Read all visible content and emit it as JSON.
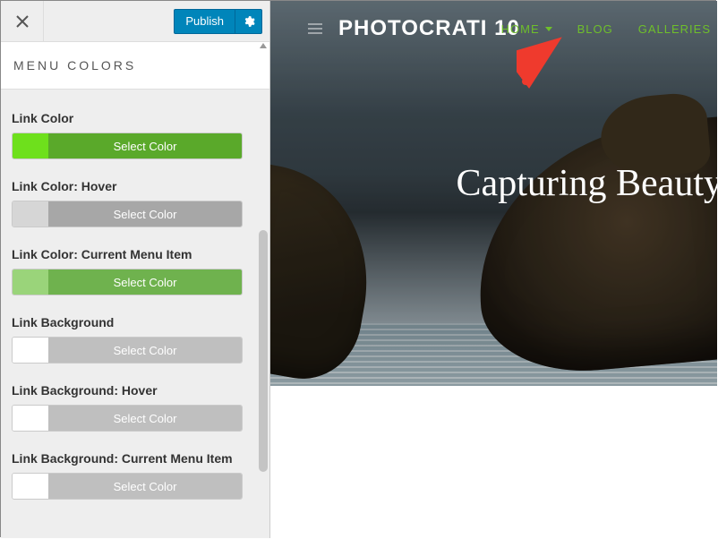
{
  "topbar": {
    "publish_label": "Publish"
  },
  "panel": {
    "title": "MENU COLORS"
  },
  "controls": [
    {
      "label": "Link Color",
      "button_label": "Select Color",
      "swatch": "#6ee01c",
      "bg": "#5aa92a"
    },
    {
      "label": "Link Color: Hover",
      "button_label": "Select Color",
      "swatch": "#d6d6d6",
      "bg": "#a7a7a7"
    },
    {
      "label": "Link Color: Current Menu Item",
      "button_label": "Select Color",
      "swatch": "#9ad47a",
      "bg": "#6fb24e"
    },
    {
      "label": "Link Background",
      "button_label": "Select Color",
      "swatch": "#ffffff",
      "bg": "#bfbfbf"
    },
    {
      "label": "Link Background: Hover",
      "button_label": "Select Color",
      "swatch": "#ffffff",
      "bg": "#bfbfbf"
    },
    {
      "label": "Link Background: Current Menu Item",
      "button_label": "Select Color",
      "swatch": "#ffffff",
      "bg": "#bfbfbf"
    }
  ],
  "preview": {
    "brand": "PHOTOCRATI 10",
    "nav": {
      "home": "HOME",
      "blog": "BLOG",
      "galleries": "GALLERIES"
    },
    "hero_title": "Capturing Beauty"
  }
}
